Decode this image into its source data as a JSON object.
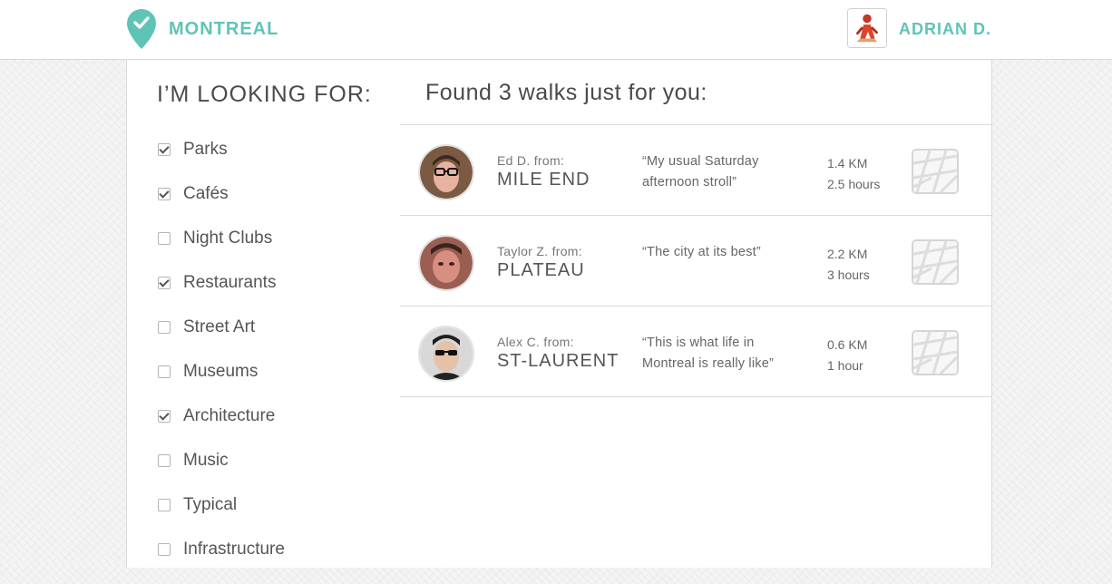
{
  "header": {
    "city": "MONTREAL",
    "user_name": "ADRIAN D.",
    "accent_color": "#5fc4b6",
    "logo_icon": "map-pin-icon",
    "avatar_icon": "user-avatar-icon"
  },
  "sidebar": {
    "title": "I’M LOOKING FOR:",
    "filters": [
      {
        "label": "Parks",
        "checked": true
      },
      {
        "label": "Cafés",
        "checked": true
      },
      {
        "label": "Night Clubs",
        "checked": false
      },
      {
        "label": "Restaurants",
        "checked": true
      },
      {
        "label": "Street Art",
        "checked": false
      },
      {
        "label": "Museums",
        "checked": false
      },
      {
        "label": "Architecture",
        "checked": true
      },
      {
        "label": "Music",
        "checked": false
      },
      {
        "label": "Typical",
        "checked": false
      },
      {
        "label": "Infrastructure",
        "checked": false
      }
    ]
  },
  "results": {
    "heading": "Found 3 walks just for you:",
    "walks": [
      {
        "from": "Ed D. from:",
        "neighborhood": "MILE END",
        "quote": "“My usual Saturday afternoon stroll”",
        "distance": "1.4 KM",
        "duration": "2.5 hours",
        "map_icon": "map-thumbnail-icon"
      },
      {
        "from": "Taylor Z. from:",
        "neighborhood": "PLATEAU",
        "quote": "“The city at its best”",
        "distance": "2.2 KM",
        "duration": "3 hours",
        "map_icon": "map-thumbnail-icon"
      },
      {
        "from": "Alex C. from:",
        "neighborhood": "ST-LAURENT",
        "quote": "“This is what life in Montreal is really like”",
        "distance": "0.6 KM",
        "duration": "1 hour",
        "map_icon": "map-thumbnail-icon"
      }
    ]
  }
}
